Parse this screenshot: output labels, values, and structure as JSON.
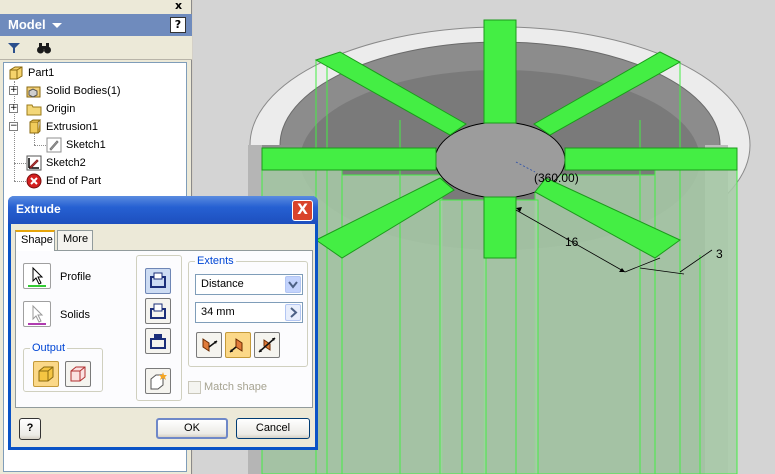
{
  "browser": {
    "title": "Model",
    "help_label": "?",
    "close_label": "x",
    "toolbar": {
      "filter_icon": "filter-icon",
      "find_icon": "binoculars-icon"
    },
    "tree": [
      {
        "label": "Part1",
        "icon": "part-icon"
      },
      {
        "label": "Solid Bodies(1)",
        "icon": "solid-bodies-icon"
      },
      {
        "label": "Origin",
        "icon": "folder-icon"
      },
      {
        "label": "Extrusion1",
        "icon": "extrusion-icon"
      },
      {
        "label": "Sketch1",
        "icon": "sketch-icon"
      },
      {
        "label": "Sketch2",
        "icon": "sketch-icon"
      },
      {
        "label": "End of Part",
        "icon": "end-of-part-icon"
      }
    ]
  },
  "viewport": {
    "dimensions": {
      "angle": "(360.00)",
      "length": "16",
      "width": "3"
    },
    "colors": {
      "highlight": "#44ee44",
      "body": "#8c8c8c",
      "preview": "#a6c9a6"
    }
  },
  "dialog": {
    "title": "Extrude",
    "close_label": "X",
    "tabs": [
      "Shape",
      "More"
    ],
    "profile_label": "Profile",
    "solids_label": "Solids",
    "output_label": "Output",
    "extents_label": "Extents",
    "extents_value": "Distance",
    "distance_value": "34 mm",
    "match_shape_label": "Match shape",
    "ok_label": "OK",
    "cancel_label": "Cancel",
    "help_label": "?"
  }
}
